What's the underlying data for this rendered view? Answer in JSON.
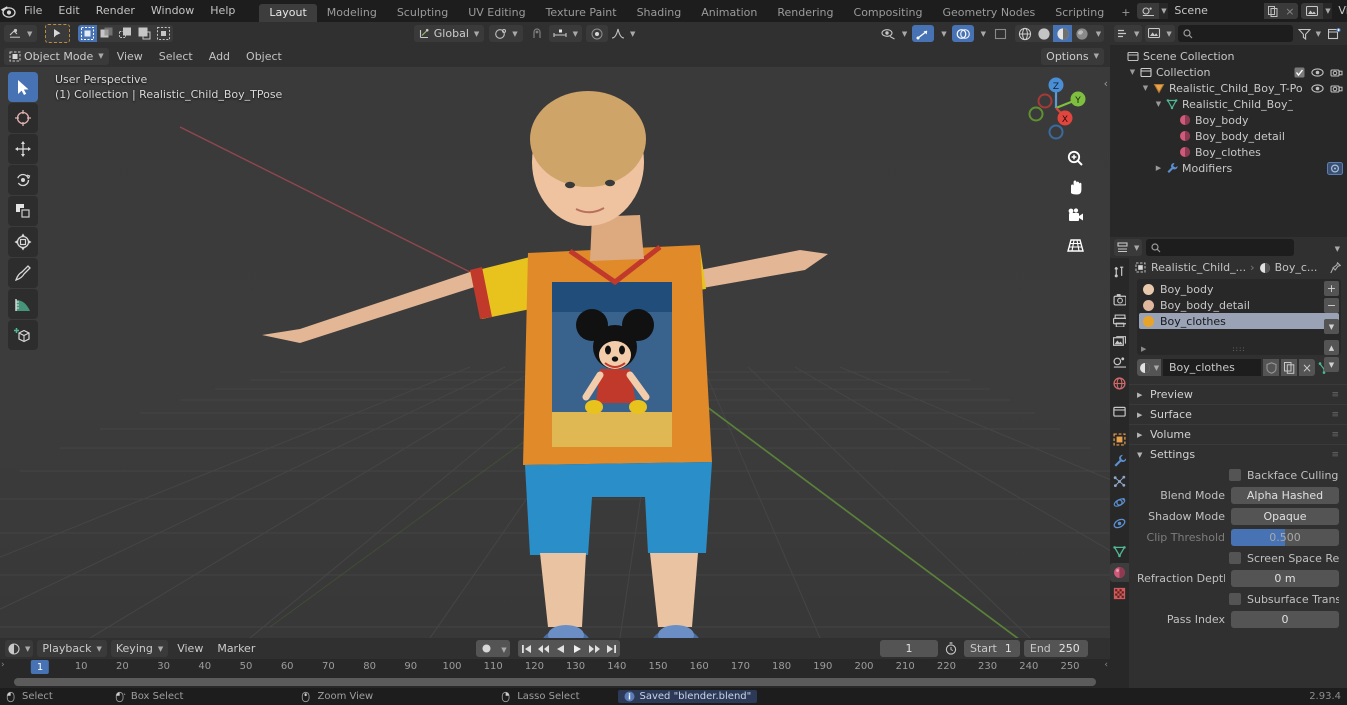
{
  "app": {
    "version": "2.93.4",
    "logo_icon": "blender-logo-icon"
  },
  "topbar": {
    "menus": [
      "File",
      "Edit",
      "Render",
      "Window",
      "Help"
    ],
    "workspace_tabs": [
      {
        "label": "Layout",
        "active": true
      },
      {
        "label": "Modeling",
        "active": false
      },
      {
        "label": "Sculpting",
        "active": false
      },
      {
        "label": "UV Editing",
        "active": false
      },
      {
        "label": "Texture Paint",
        "active": false
      },
      {
        "label": "Shading",
        "active": false
      },
      {
        "label": "Animation",
        "active": false
      },
      {
        "label": "Rendering",
        "active": false
      },
      {
        "label": "Compositing",
        "active": false
      },
      {
        "label": "Geometry Nodes",
        "active": false
      },
      {
        "label": "Scripting",
        "active": false
      }
    ],
    "add_workspace_label": "+",
    "scene": {
      "name": "Scene",
      "new_label": "",
      "unlink_label": "×"
    },
    "view_layer": {
      "name": "View Layer",
      "new_label": "",
      "unlink_label": "×"
    }
  },
  "viewport_header": {
    "editor_type_icon": "editor-type-icon",
    "mode": "Object Mode",
    "menus": [
      "View",
      "Select",
      "Add",
      "Object"
    ],
    "transform_orientation": "Global",
    "options_label": "Options",
    "select_modes": [
      "tweak",
      "box-select",
      "circle-select",
      "lasso-select",
      "select-mode-4"
    ],
    "snap_label": "",
    "proportional_label": ""
  },
  "viewport": {
    "overlay_line1": "User Perspective",
    "overlay_line2": "(1) Collection | Realistic_Child_Boy_TPose",
    "tools": [
      {
        "name": "tweak-tool",
        "icon": "cursor-arrow-icon",
        "active": true
      },
      {
        "name": "cursor-tool",
        "icon": "crosshair-icon",
        "active": false
      },
      {
        "name": "move-tool",
        "icon": "move-arrows-icon",
        "active": false
      },
      {
        "name": "rotate-tool",
        "icon": "rotate-icon",
        "active": false
      },
      {
        "name": "scale-tool",
        "icon": "scale-icon",
        "active": false
      },
      {
        "name": "transform-tool",
        "icon": "transform-icon",
        "active": false
      },
      {
        "name": "annotate-tool",
        "icon": "pencil-icon",
        "active": false
      },
      {
        "name": "measure-tool",
        "icon": "ruler-icon",
        "active": false
      },
      {
        "name": "add-cube-tool",
        "icon": "add-cube-icon",
        "active": false
      }
    ],
    "gizmo_axes": [
      "X",
      "Y",
      "Z"
    ],
    "nav_buttons": [
      "zoom-icon",
      "pan-hand-icon",
      "camera-icon",
      "perspective-grid-icon"
    ]
  },
  "outliner": {
    "header": {
      "display_mode_icon": "outliner-display-mode-icon",
      "filter_icon": "filter-funnel-icon",
      "new_collection_icon": "new-collection-icon",
      "search_placeholder": ""
    },
    "rows": [
      {
        "indent": 0,
        "tri": "",
        "icon": "scene-collection-icon",
        "label": "Scene Collection",
        "selected": false,
        "restrict": []
      },
      {
        "indent": 1,
        "tri": "down",
        "icon": "collection-icon",
        "label": "Collection",
        "selected": false,
        "restrict": [
          "checkbox",
          "eye",
          "camera"
        ]
      },
      {
        "indent": 2,
        "tri": "down",
        "icon": "object-empty-icon",
        "label": "Realistic_Child_Boy_T-Po",
        "selected": false,
        "restrict": [
          "eye",
          "camera"
        ]
      },
      {
        "indent": 3,
        "tri": "down",
        "icon": "mesh-data-icon",
        "label": "Realistic_Child_Boy_̄",
        "selected": false,
        "restrict": []
      },
      {
        "indent": 4,
        "tri": "",
        "icon": "material-icon",
        "label": "Boy_body",
        "selected": false,
        "restrict": []
      },
      {
        "indent": 4,
        "tri": "",
        "icon": "material-icon",
        "label": "Boy_body_detail",
        "selected": false,
        "restrict": []
      },
      {
        "indent": 4,
        "tri": "",
        "icon": "material-icon",
        "label": "Boy_clothes",
        "selected": false,
        "restrict": []
      },
      {
        "indent": 3,
        "tri": "right",
        "icon": "modifier-wrench-icon",
        "label": "Modifiers",
        "selected": false,
        "restrict": [
          "modifier-badge"
        ]
      }
    ]
  },
  "properties": {
    "header": {
      "editor_icon": "properties-editor-icon",
      "search_placeholder": "",
      "options_chevron": "chevron-down-icon"
    },
    "tabs": [
      {
        "name": "tool",
        "icon": "tool-icon",
        "active": false,
        "color": "#d2d2d2"
      },
      {
        "name": "render",
        "icon": "camera-back-icon",
        "active": false,
        "color": "#d2d2d2"
      },
      {
        "name": "output",
        "icon": "printer-icon",
        "active": false,
        "color": "#d2d2d2"
      },
      {
        "name": "view-layer",
        "icon": "images-icon",
        "active": false,
        "color": "#d2d2d2"
      },
      {
        "name": "scene",
        "icon": "scene-cone-icon",
        "active": false,
        "color": "#d2d2d2"
      },
      {
        "name": "world",
        "icon": "world-globe-icon",
        "active": false,
        "color": "#d06a6a"
      },
      {
        "name": "collection",
        "icon": "collection-box-icon",
        "active": false,
        "color": "#d2d2d2"
      },
      {
        "name": "object",
        "icon": "object-square-icon",
        "active": false,
        "color": "#e8a04a"
      },
      {
        "name": "modifiers",
        "icon": "wrench-icon",
        "active": false,
        "color": "#5b8fd0"
      },
      {
        "name": "particles",
        "icon": "particles-icon",
        "active": false,
        "color": "#8fa8c8"
      },
      {
        "name": "physics",
        "icon": "physics-orbit-icon",
        "active": false,
        "color": "#5b8fd0"
      },
      {
        "name": "constraints",
        "icon": "constraint-icon",
        "active": false,
        "color": "#5b8fd0"
      },
      {
        "name": "data",
        "icon": "mesh-data-triangle-icon",
        "active": false,
        "color": "#4fb896"
      },
      {
        "name": "material",
        "icon": "material-sphere-icon",
        "active": true,
        "color": "#d05a7a"
      },
      {
        "name": "texture",
        "icon": "texture-checker-icon",
        "active": false,
        "color": "#d05a5a"
      }
    ],
    "breadcrumb": [
      {
        "icon": "object-square-icon",
        "label": "Realistic_Child_..."
      },
      {
        "icon": "material-sphere-icon",
        "label": "Boy_c..."
      }
    ],
    "pin_icon": "pin-icon",
    "material_slots": [
      {
        "label": "Boy_body",
        "color": "#e8c9ae",
        "selected": false
      },
      {
        "label": "Boy_body_detail",
        "color": "#e0b89d",
        "selected": false
      },
      {
        "label": "Boy_clothes",
        "color": "#e8a42a",
        "selected": true
      }
    ],
    "slot_buttons": {
      "add": "+",
      "remove": "−",
      "menu": "chevron-down-icon",
      "up": "▲",
      "down": "▼"
    },
    "active_material": {
      "browse_icon": "material-sphere-icon",
      "name": "Boy_clothes",
      "fake_user_icon": "shield-icon",
      "copy_icon": "copy-icon",
      "unlink_icon": "x-icon",
      "nodes_icon": "nodes-icon"
    },
    "panels": [
      {
        "label": "Preview",
        "open": false
      },
      {
        "label": "Surface",
        "open": false
      },
      {
        "label": "Volume",
        "open": false
      },
      {
        "label": "Settings",
        "open": true
      }
    ],
    "settings": {
      "backface_culling": {
        "label": "Backface Culling",
        "checked": false
      },
      "blend_mode": {
        "label": "Blend Mode",
        "value": "Alpha Hashed"
      },
      "shadow_mode": {
        "label": "Shadow Mode",
        "value": "Opaque"
      },
      "clip_threshold": {
        "label": "Clip Threshold",
        "value": "0.500",
        "fill_percent": 50,
        "disabled": true
      },
      "screen_space_refraction": {
        "label": "Screen Space Refract...",
        "checked": false
      },
      "refraction_depth": {
        "label": "Refraction Depth",
        "value": "0 m"
      },
      "subsurface_translucency": {
        "label": "Subsurface Transluce...",
        "checked": false
      },
      "pass_index": {
        "label": "Pass Index",
        "value": "0"
      }
    }
  },
  "timeline": {
    "editor_icon": "timeline-editor-icon",
    "menus": [
      "Playback",
      "Keying",
      "View",
      "Marker"
    ],
    "record_icon": "record-dot-icon",
    "playback_buttons": [
      "jump-start-icon",
      "prev-keyframe-icon",
      "play-reverse-icon",
      "play-icon",
      "next-keyframe-icon",
      "jump-end-icon"
    ],
    "current_frame": "1",
    "auto_key_icon": "stopwatch-icon",
    "start_label": "Start",
    "start_value": "1",
    "end_label": "End",
    "end_value": "250",
    "tick_labels": [
      "1",
      "10",
      "20",
      "30",
      "40",
      "50",
      "60",
      "70",
      "80",
      "90",
      "100",
      "110",
      "120",
      "130",
      "140",
      "150",
      "160",
      "170",
      "180",
      "190",
      "200",
      "210",
      "220",
      "230",
      "240",
      "250"
    ],
    "playhead_frame": "1"
  },
  "statusbar": {
    "hints": [
      {
        "icon": "mouse-left-icon",
        "label": "Select"
      },
      {
        "icon": "mouse-left-drag-icon",
        "label": "Box Select"
      },
      {
        "icon": "mouse-middle-icon",
        "label": "Zoom View"
      },
      {
        "icon": "mouse-right-icon",
        "label": "Lasso Select"
      }
    ],
    "report": {
      "icon": "info-icon",
      "text": "Saved \"blender.blend\""
    },
    "version": "2.93.4"
  }
}
